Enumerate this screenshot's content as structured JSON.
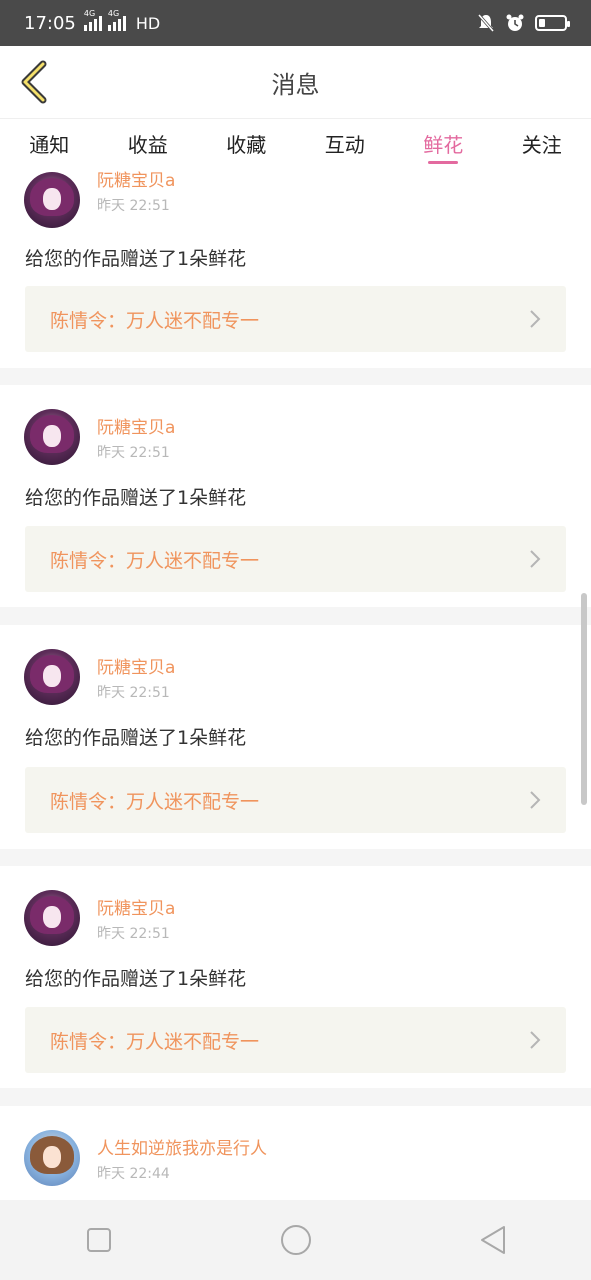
{
  "status_bar": {
    "time": "17:05",
    "network1": "4G",
    "network2": "4G",
    "hd": "HD"
  },
  "header": {
    "title": "消息",
    "back_icon": "chevron-left-icon"
  },
  "tabs": [
    {
      "label": "通知",
      "active": false
    },
    {
      "label": "收益",
      "active": false
    },
    {
      "label": "收藏",
      "active": false
    },
    {
      "label": "互动",
      "active": false
    },
    {
      "label": "鲜花",
      "active": true
    },
    {
      "label": "关注",
      "active": false
    }
  ],
  "colors": {
    "accent_pink": "#e36a9f",
    "accent_orange": "#f0945d",
    "status_bar": "#4a4a4a"
  },
  "messages": [
    {
      "user": "阮糖宝贝a",
      "time": "昨天 22:51",
      "action": "给您的作品赠送了1朵鲜花",
      "work": "陈情令：万人迷不配专一"
    },
    {
      "user": "阮糖宝贝a",
      "time": "昨天 22:51",
      "action": "给您的作品赠送了1朵鲜花",
      "work": "陈情令：万人迷不配专一"
    },
    {
      "user": "阮糖宝贝a",
      "time": "昨天 22:51",
      "action": "给您的作品赠送了1朵鲜花",
      "work": "陈情令：万人迷不配专一"
    },
    {
      "user": "阮糖宝贝a",
      "time": "昨天 22:51",
      "action": "给您的作品赠送了1朵鲜花",
      "work": "陈情令：万人迷不配专一"
    },
    {
      "user": "人生如逆旅我亦是行人",
      "time": "昨天 22:44",
      "action": "",
      "work": ""
    }
  ],
  "nav": {
    "recent": "square-icon",
    "home": "circle-icon",
    "back": "triangle-back-icon"
  }
}
